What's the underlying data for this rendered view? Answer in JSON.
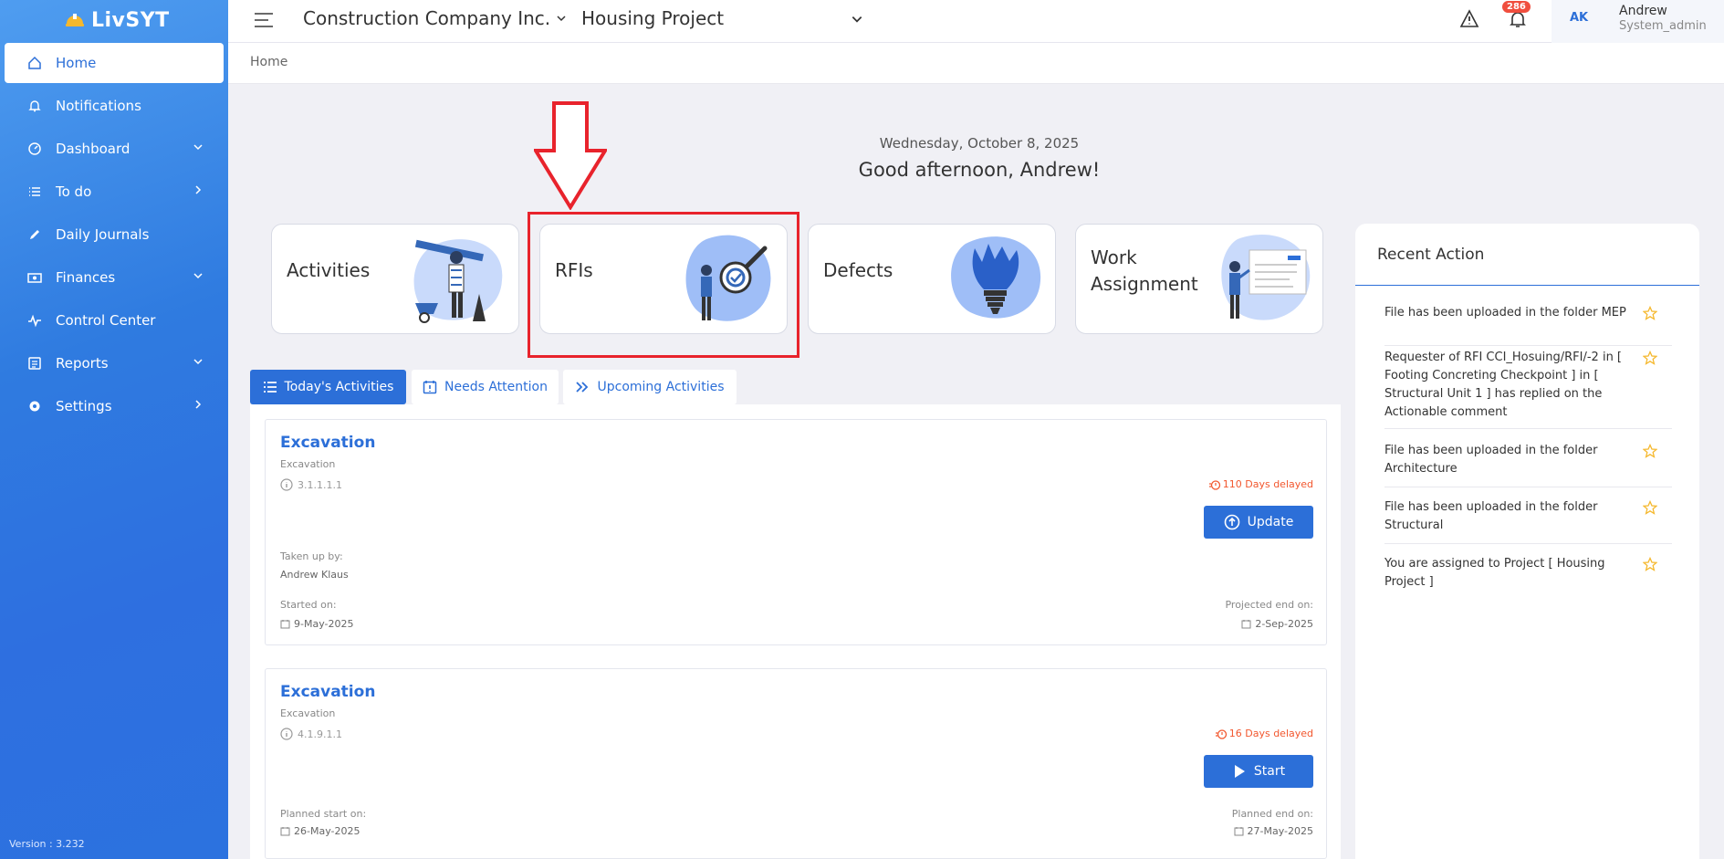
{
  "sidebar": {
    "brand": "LivSYT",
    "items": [
      {
        "label": "Home"
      },
      {
        "label": "Notifications"
      },
      {
        "label": "Dashboard"
      },
      {
        "label": "To do"
      },
      {
        "label": "Daily Journals"
      },
      {
        "label": "Finances"
      },
      {
        "label": "Control Center"
      },
      {
        "label": "Reports"
      },
      {
        "label": "Settings"
      }
    ],
    "version": "Version : 3.232"
  },
  "topbar": {
    "company": "Construction Company Inc.",
    "project": "Housing Project",
    "notif_count": "286",
    "user_initials": "AK",
    "user_name": "Andrew",
    "user_role": "System_admin"
  },
  "breadcrumb": "Home",
  "greeting": {
    "date": "Wednesday, October 8, 2025",
    "message": "Good afternoon, Andrew!"
  },
  "cards": [
    {
      "title": "Activities"
    },
    {
      "title": "RFIs"
    },
    {
      "title": "Defects"
    },
    {
      "title_line1": "Work",
      "title_line2": "Assignment"
    }
  ],
  "tabs": [
    {
      "label": "Today's Activities"
    },
    {
      "label": "Needs Attention"
    },
    {
      "label": "Upcoming Activities"
    }
  ],
  "activities": [
    {
      "title": "Excavation",
      "subtitle": "Excavation",
      "code": "3.1.1.1.1",
      "delay": "110 Days delayed",
      "button": "Update",
      "taken_label": "Taken up by:",
      "taken_value": "Andrew Klaus",
      "start_label": "Started on:",
      "start_value": "9-May-2025",
      "end_label": "Projected end on:",
      "end_value": "2-Sep-2025"
    },
    {
      "title": "Excavation",
      "subtitle": "Excavation",
      "code": "4.1.9.1.1",
      "delay": "16 Days delayed",
      "button": "Start",
      "start_label": "Planned start on:",
      "start_value": "26-May-2025",
      "end_label": "Planned end on:",
      "end_value": "27-May-2025"
    }
  ],
  "recent": {
    "title": "Recent Action",
    "items": [
      {
        "text": "File has been uploaded in the folder MEP"
      },
      {
        "text": "Requester of RFI CCI_Hosuing/RFI/-2 in [ Footing Concreting Checkpoint ] in [ Structural Unit 1 ] has replied on the Actionable comment"
      },
      {
        "text": "File has been uploaded in the folder Architecture"
      },
      {
        "text": "File has been uploaded in the folder Structural"
      },
      {
        "text": "You are assigned to Project [ Housing Project ]"
      }
    ]
  },
  "colors": {
    "accent": "#2c6fd8",
    "highlight": "#e8232c",
    "delay": "#f2572e",
    "star": "#f5b82e"
  }
}
